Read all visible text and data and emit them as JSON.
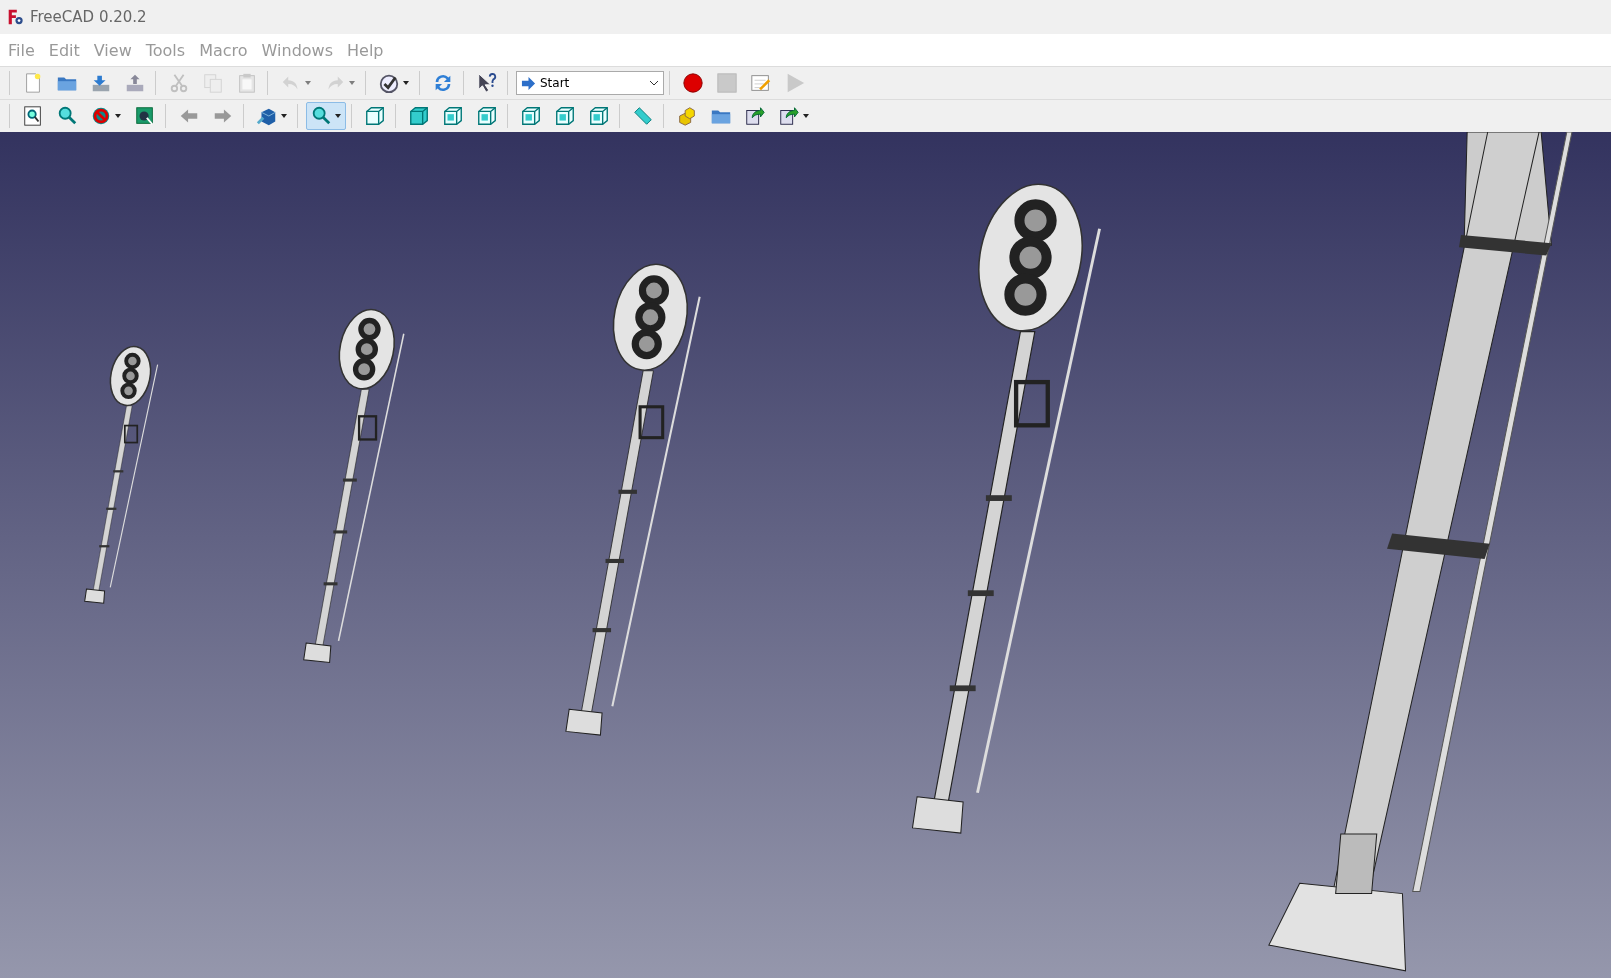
{
  "window": {
    "title": "FreeCAD 0.20.2"
  },
  "menu": [
    "File",
    "Edit",
    "View",
    "Tools",
    "Macro",
    "Windows",
    "Help"
  ],
  "toolbar_rows": [
    [
      [
        {
          "kind": "new",
          "disabled": false,
          "pressed": false,
          "dropdown": false
        },
        {
          "kind": "open",
          "disabled": false,
          "pressed": false,
          "dropdown": false
        },
        {
          "kind": "save",
          "disabled": false,
          "pressed": false,
          "dropdown": false
        },
        {
          "kind": "export",
          "disabled": false,
          "pressed": false,
          "dropdown": false
        }
      ],
      [
        {
          "kind": "cut",
          "disabled": true,
          "pressed": false,
          "dropdown": false
        },
        {
          "kind": "copy",
          "disabled": true,
          "pressed": false,
          "dropdown": false
        },
        {
          "kind": "paste",
          "disabled": true,
          "pressed": false,
          "dropdown": false
        }
      ],
      [
        {
          "kind": "undo",
          "disabled": true,
          "pressed": false,
          "dropdown": true
        },
        {
          "kind": "redo",
          "disabled": true,
          "pressed": false,
          "dropdown": true
        }
      ],
      [
        {
          "kind": "check",
          "disabled": false,
          "pressed": false,
          "dropdown": true
        }
      ],
      [
        {
          "kind": "refresh",
          "disabled": false,
          "pressed": false,
          "dropdown": false
        }
      ],
      [
        {
          "kind": "whatsthis",
          "disabled": false,
          "pressed": false,
          "dropdown": false
        }
      ]
    ],
    [
      [
        {
          "kind": "fitall",
          "disabled": false,
          "pressed": false,
          "dropdown": false
        },
        {
          "kind": "fitselection",
          "disabled": false,
          "pressed": false,
          "dropdown": false
        },
        {
          "kind": "drawstyle",
          "disabled": false,
          "pressed": false,
          "dropdown": true
        },
        {
          "kind": "boundingbox",
          "disabled": false,
          "pressed": false,
          "dropdown": false
        }
      ],
      [
        {
          "kind": "back",
          "disabled": false,
          "pressed": false,
          "dropdown": false
        },
        {
          "kind": "forward",
          "disabled": false,
          "pressed": false,
          "dropdown": false
        }
      ],
      [
        {
          "kind": "isometric",
          "disabled": false,
          "pressed": false,
          "dropdown": true
        }
      ],
      [
        {
          "kind": "zoom",
          "disabled": false,
          "pressed": true,
          "dropdown": true
        }
      ],
      [
        {
          "kind": "viewiso",
          "disabled": false,
          "pressed": false,
          "dropdown": false
        }
      ],
      [
        {
          "kind": "viewfront",
          "disabled": false,
          "pressed": false,
          "dropdown": false
        },
        {
          "kind": "viewtop",
          "disabled": false,
          "pressed": false,
          "dropdown": false
        },
        {
          "kind": "viewright",
          "disabled": false,
          "pressed": false,
          "dropdown": false
        }
      ],
      [
        {
          "kind": "viewrear",
          "disabled": false,
          "pressed": false,
          "dropdown": false
        },
        {
          "kind": "viewbottom",
          "disabled": false,
          "pressed": false,
          "dropdown": false
        },
        {
          "kind": "viewleft",
          "disabled": false,
          "pressed": false,
          "dropdown": false
        }
      ],
      [
        {
          "kind": "measure",
          "disabled": false,
          "pressed": false,
          "dropdown": false
        }
      ],
      [
        {
          "kind": "part",
          "disabled": false,
          "pressed": false,
          "dropdown": false
        },
        {
          "kind": "group",
          "disabled": false,
          "pressed": false,
          "dropdown": false
        },
        {
          "kind": "link",
          "disabled": false,
          "pressed": false,
          "dropdown": false
        },
        {
          "kind": "linkactions",
          "disabled": false,
          "pressed": false,
          "dropdown": true
        }
      ]
    ]
  ],
  "workbench": {
    "value": "Start"
  },
  "macro": [
    {
      "kind": "record",
      "disabled": false,
      "pressed": false,
      "dropdown": false
    },
    {
      "kind": "stop",
      "disabled": true,
      "pressed": false,
      "dropdown": false
    },
    {
      "kind": "editmacro",
      "disabled": false,
      "pressed": false,
      "dropdown": false
    },
    {
      "kind": "play",
      "disabled": true,
      "pressed": false,
      "dropdown": false
    }
  ]
}
